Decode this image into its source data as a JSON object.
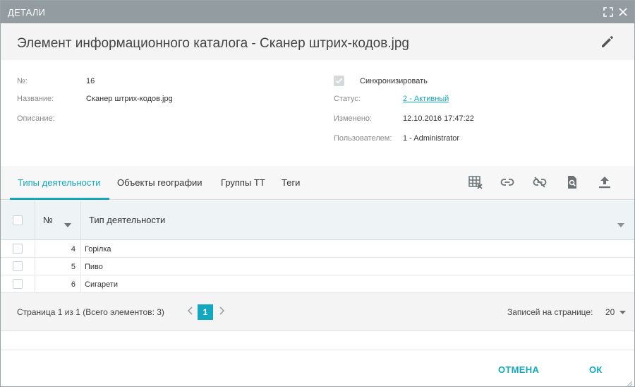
{
  "window": {
    "title": "ДЕТАЛИ",
    "maximize_icon": "maximize-icon",
    "close_icon": "close-icon"
  },
  "header": {
    "title": "Элемент информационного каталога - Сканер штрих-кодов.jpg",
    "edit_icon": "pencil-icon"
  },
  "details": {
    "left": [
      {
        "label": "№:",
        "value": "16"
      },
      {
        "label": "Название:",
        "value": "Сканер штрих-кодов.jpg"
      },
      {
        "label": "Описание:",
        "value": ""
      }
    ],
    "sync_label": "Синхронизировать",
    "sync_checked": true,
    "status_label": "Статус:",
    "status_value": "2 - Активный",
    "modified_label": "Изменено:",
    "modified_value": "12.10.2016 17:47:22",
    "user_label": "Пользователем:",
    "user_value": "1 - Administrator"
  },
  "tabs": [
    {
      "label": "Типы деятельности",
      "active": true
    },
    {
      "label": "Объекты географии",
      "active": false
    },
    {
      "label": "Группы ТТ",
      "active": false
    },
    {
      "label": "Теги",
      "active": false
    }
  ],
  "toolbar": [
    "clear-filter-icon",
    "link-icon",
    "unlink-icon",
    "document-search-icon",
    "upload-icon"
  ],
  "grid": {
    "columns": {
      "num": "№",
      "type": "Тип деятельности"
    },
    "rows": [
      {
        "num": "4",
        "name": "Горілка"
      },
      {
        "num": "5",
        "name": "Пиво"
      },
      {
        "num": "6",
        "name": "Сигарети"
      }
    ]
  },
  "pager": {
    "info": "Страница 1 из 1 (Всего элементов: 3)",
    "current_page": "1",
    "page_size_label": "Записей на странице:",
    "page_size": "20"
  },
  "footer": {
    "cancel_label": "ОТМЕНА",
    "ok_label": "ОК"
  },
  "colors": {
    "accent": "#14a7c0",
    "titlebar": "#939ca1"
  }
}
